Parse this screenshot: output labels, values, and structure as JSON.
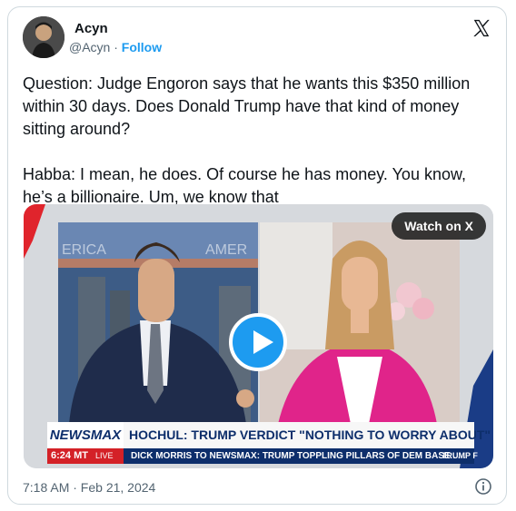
{
  "author": {
    "display_name": "Acyn",
    "handle": "@Acyn",
    "separator": "·",
    "follow_label": "Follow"
  },
  "tweet": {
    "text": "Question: Judge Engoron says that he wants this $350 million within 30 days. Does Donald Trump have that kind of money sitting around?\n\nHabba: I mean, he does. Of course he has money. You know, he’s a billionaire. Um, we know that",
    "timestamp": "7:18 AM · Feb 21, 2024"
  },
  "media": {
    "watch_label": "Watch on X",
    "broadcast": {
      "network": "NEWSMAX",
      "headline": "HOCHUL: TRUMP VERDICT \"NOTHING TO WORRY ABOUT\" FOR NY BUSINESSES",
      "time": "6:24 MT",
      "live": "LIVE",
      "ticker": "DICK MORRIS TO NEWSMAX: TRUMP TOPPLING PILLARS OF DEM BASE . . .",
      "ticker_next": "TRUMP F",
      "backdrop_left": "ERICA",
      "backdrop_right": "AMER"
    }
  },
  "icons": {
    "platform_logo": "x-logo-icon",
    "play": "play-icon",
    "info": "info-icon"
  },
  "colors": {
    "link_blue": "#1d9bf0",
    "newsmax_navy": "#0d2e6b",
    "newsmax_red": "#d42127"
  }
}
